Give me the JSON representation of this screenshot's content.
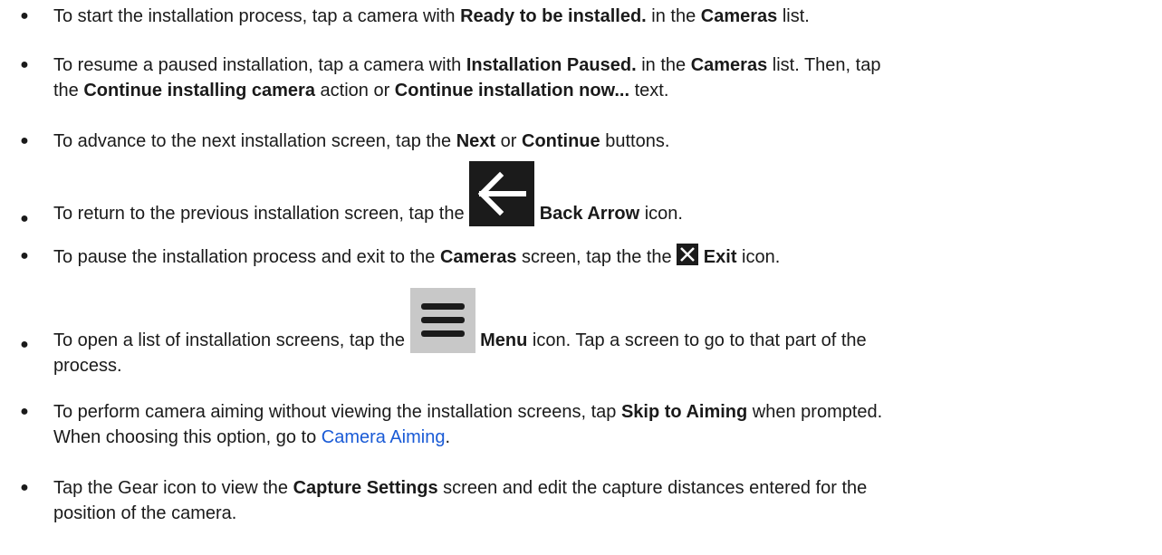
{
  "items": [
    {
      "parts": [
        {
          "t": "To start the installation process, tap a camera with "
        },
        {
          "b": "Ready to be installed."
        },
        {
          "t": " in the "
        },
        {
          "b": "Cameras"
        },
        {
          "t": " list."
        }
      ]
    },
    {
      "line1": [
        {
          "t": "To resume a paused installation, tap a camera with "
        },
        {
          "b": "Installation Paused."
        },
        {
          "t": " in the "
        },
        {
          "b": "Cameras"
        },
        {
          "t": " list. Then, tap"
        }
      ],
      "line2": [
        {
          "t": "the "
        },
        {
          "b": "Continue installing camera"
        },
        {
          "t": " action or "
        },
        {
          "b": "Continue installation now..."
        },
        {
          "t": " text."
        }
      ]
    },
    {
      "parts": [
        {
          "t": "To advance to the next installation screen, tap the "
        },
        {
          "b": "Next"
        },
        {
          "t": " or "
        },
        {
          "b": "Continue"
        },
        {
          "t": " buttons."
        }
      ]
    },
    {
      "before": "To return to the previous installation screen, tap the ",
      "icon": "back-arrow-icon",
      "bold": "Back Arrow",
      "after": " icon."
    },
    {
      "before": "To pause the installation process and exit to the ",
      "bold1": "Cameras",
      "middle": " screen, tap the the ",
      "icon": "exit-x-icon",
      "bold2": "Exit",
      "after": " icon."
    },
    {
      "before": "To open a list of installation screens, tap the ",
      "icon": "hamburger-menu-icon",
      "bold": "Menu",
      "after": " icon. Tap a screen to go to that part of the",
      "line2": "process."
    },
    {
      "line1_before": "To perform camera aiming without viewing the installation screens, tap ",
      "line1_bold": "Skip to Aiming",
      "line1_after": " when prompted.",
      "line2_before": "When choosing this option, go to ",
      "line2_link": "Camera Aiming",
      "line2_after": "."
    },
    {
      "line1_before": "Tap the Gear icon to view the ",
      "line1_bold": "Capture Settings",
      "line1_after": " screen and edit the capture distances entered for the",
      "line2": "position of the camera."
    }
  ],
  "colors": {
    "text": "#1a1a1a",
    "link": "#1a5bd6",
    "back_icon_bg": "#1b1b1b",
    "menu_icon_bg": "#c8c8c8"
  }
}
